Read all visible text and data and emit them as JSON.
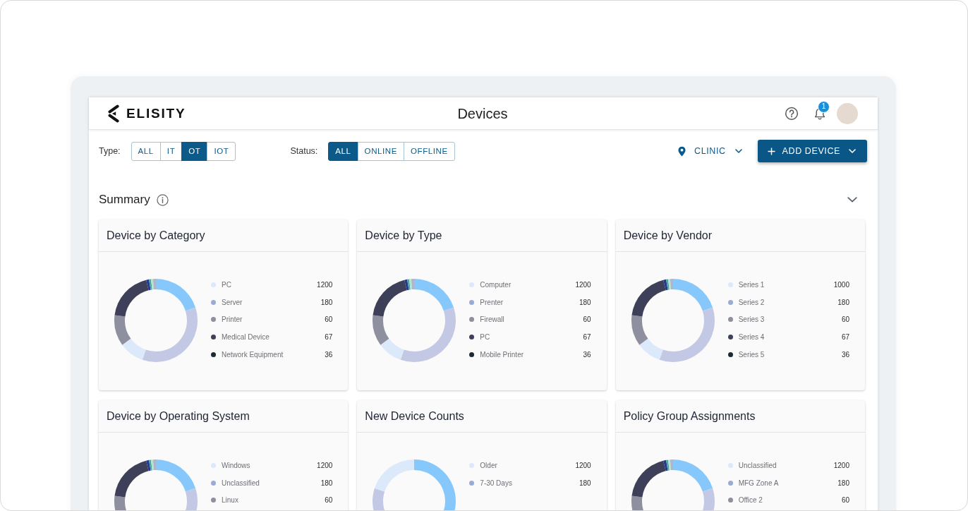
{
  "top_bar": {
    "logo": "ELISITY",
    "title": "Devices",
    "notifications": "1"
  },
  "filters": [
    {
      "label": "Type:",
      "options": [
        {
          "label": "ALL",
          "selected": false
        },
        {
          "label": "IT",
          "selected": false
        },
        {
          "label": "OT",
          "selected": true
        },
        {
          "label": "IOT",
          "selected": false
        }
      ]
    },
    {
      "label": "Status:",
      "options": [
        {
          "label": "ALL",
          "selected": true
        },
        {
          "label": "ONLINE",
          "selected": false
        },
        {
          "label": "OFFLINE",
          "selected": false
        }
      ]
    }
  ],
  "location": {
    "label": "CLINIC"
  },
  "add_button": {
    "label": "ADD DEVICE"
  },
  "summary": {
    "title": "Summary"
  },
  "cards": [
    {
      "title": "Device by Category",
      "legend": [
        {
          "label": "PC",
          "value": "1200",
          "color": "#dce9fb"
        },
        {
          "label": "Server",
          "value": "180",
          "color": "#9aabd6"
        },
        {
          "label": "Printer",
          "value": "60",
          "color": "#8e909f"
        },
        {
          "label": "Medical Device",
          "value": "67",
          "color": "#3e4059"
        },
        {
          "label": "Network Equipment",
          "value": "36",
          "color": "#1b2b33"
        }
      ]
    },
    {
      "title": "Device by Type",
      "legend": [
        {
          "label": "Computer",
          "value": "1200",
          "color": "#dce9fb"
        },
        {
          "label": "Prenter",
          "value": "180",
          "color": "#9aabd6"
        },
        {
          "label": "Firewall",
          "value": "60",
          "color": "#8e909f"
        },
        {
          "label": "PC",
          "value": "67",
          "color": "#3e4059"
        },
        {
          "label": "Mobile Printer",
          "value": "36",
          "color": "#1b2b33"
        }
      ]
    },
    {
      "title": "Device by Vendor",
      "legend": [
        {
          "label": "Series 1",
          "value": "1000",
          "color": "#dce9fb"
        },
        {
          "label": "Series 2",
          "value": "180",
          "color": "#9aabd6"
        },
        {
          "label": "Series 3",
          "value": "60",
          "color": "#8e909f"
        },
        {
          "label": "Series 4",
          "value": "67",
          "color": "#3e4059"
        },
        {
          "label": "Series 5",
          "value": "36",
          "color": "#1b2b33"
        }
      ]
    },
    {
      "title": "Device by Operating System",
      "legend": [
        {
          "label": "Windows",
          "value": "1200",
          "color": "#dce9fb"
        },
        {
          "label": "Unclassified",
          "value": "180",
          "color": "#9aabd6"
        },
        {
          "label": "Linux",
          "value": "60",
          "color": "#8e909f"
        }
      ]
    },
    {
      "title": "New Device Counts",
      "legend": [
        {
          "label": "Older",
          "value": "1200",
          "color": "#dce9fb"
        },
        {
          "label": "7-30 Days",
          "value": "180",
          "color": "#9aabd6"
        }
      ]
    },
    {
      "title": "Policy Group Assignments",
      "legend": [
        {
          "label": "Unclassified",
          "value": "1200",
          "color": "#dce9fb"
        },
        {
          "label": "MFG Zone A",
          "value": "180",
          "color": "#9aabd6"
        },
        {
          "label": "Office 2",
          "value": "60",
          "color": "#8e909f"
        }
      ]
    }
  ]
}
